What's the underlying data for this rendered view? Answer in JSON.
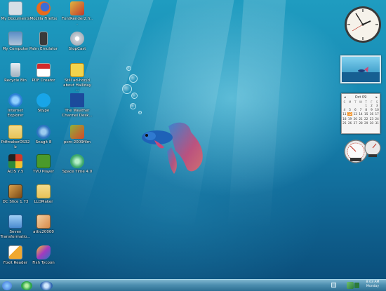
{
  "desktop_icons": [
    {
      "label": "My Documents",
      "icon": "folder-documents-icon",
      "color": "#d7dfe6"
    },
    {
      "label": "Mozilla Firefox",
      "icon": "firefox-icon",
      "color": "#e86b1c"
    },
    {
      "label": "FontRender2.fr...",
      "icon": "app-icon",
      "color": "#e0b340"
    },
    {
      "label": "My Computer",
      "icon": "computer-icon",
      "color": "#b0c4d8"
    },
    {
      "label": "Palm Emulator",
      "icon": "palm-icon",
      "color": "#3a3a3a"
    },
    {
      "label": "StopCast",
      "icon": "cd-icon",
      "color": "#c9d0d8"
    },
    {
      "label": "Recycle Bin",
      "icon": "recycle-bin-icon",
      "color": "#c0ccd6"
    },
    {
      "label": "PDF Creator",
      "icon": "pdf-icon",
      "color": "#d22b2b"
    },
    {
      "label": "Still ad-hoc/d about Halliday ...",
      "icon": "mail-icon",
      "color": "#f2d34c"
    },
    {
      "label": "Internet Explorer",
      "icon": "ie-icon",
      "color": "#2b7fd6"
    },
    {
      "label": "Skype",
      "icon": "skype-icon",
      "color": "#18a5e8"
    },
    {
      "label": "The Weather Channel Desk...",
      "icon": "weather-icon",
      "color": "#1c4a9c"
    },
    {
      "label": "PdfmakerDS32b",
      "icon": "folder-icon",
      "color": "#e8c35a"
    },
    {
      "label": "Snagit 8",
      "icon": "snagit-icon",
      "color": "#2d73c0"
    },
    {
      "label": "pcm-2009film",
      "icon": "film-icon",
      "color": "#8fb13a"
    },
    {
      "label": "ACIS 7.5",
      "icon": "acis-icon",
      "color": "#d13a2a"
    },
    {
      "label": "TVU Player",
      "icon": "tvu-icon",
      "color": "#4a9a2a"
    },
    {
      "label": "Space Time 4.0",
      "icon": "space-time-icon",
      "color": "#3ca86a"
    },
    {
      "label": "DC Slice 1.73",
      "icon": "dc-icon",
      "color": "#b7762a"
    },
    {
      "label": "LLDMaker",
      "icon": "folder-icon",
      "color": "#e8c35a"
    },
    {
      "label": "Seven Transformatio...",
      "icon": "seven-icon",
      "color": "#4a8ad0"
    },
    {
      "label": "attic20000",
      "icon": "image-icon",
      "color": "#d88a4a"
    },
    {
      "label": "Foxit Reader",
      "icon": "foxit-icon",
      "color": "#f0a830"
    },
    {
      "label": "Fish Tycoon",
      "icon": "fish-tycoon-icon",
      "color": "#a23ac0"
    }
  ],
  "calendar": {
    "month": "Oct 09",
    "day_names": [
      "S",
      "M",
      "T",
      "W",
      "T",
      "F",
      "S"
    ],
    "days": [
      "",
      "",
      "",
      "",
      "1",
      "2",
      "3",
      "4",
      "5",
      "6",
      "7",
      "8",
      "9",
      "10",
      "11",
      "12",
      "13",
      "14",
      "15",
      "16",
      "17",
      "18",
      "19",
      "20",
      "21",
      "22",
      "23",
      "24",
      "25",
      "26",
      "27",
      "28",
      "29",
      "30",
      "31"
    ],
    "today": "12"
  },
  "taskbar": {
    "start_color": "#2ea44a",
    "clock_time": "8:03 AM",
    "clock_day": "Monday"
  },
  "colors": {
    "desktop_top": "#1f9cc0",
    "desktop_bottom": "#0b4f7c",
    "fish_body": "#1e62b8",
    "fish_fin": "#d24a6a"
  }
}
